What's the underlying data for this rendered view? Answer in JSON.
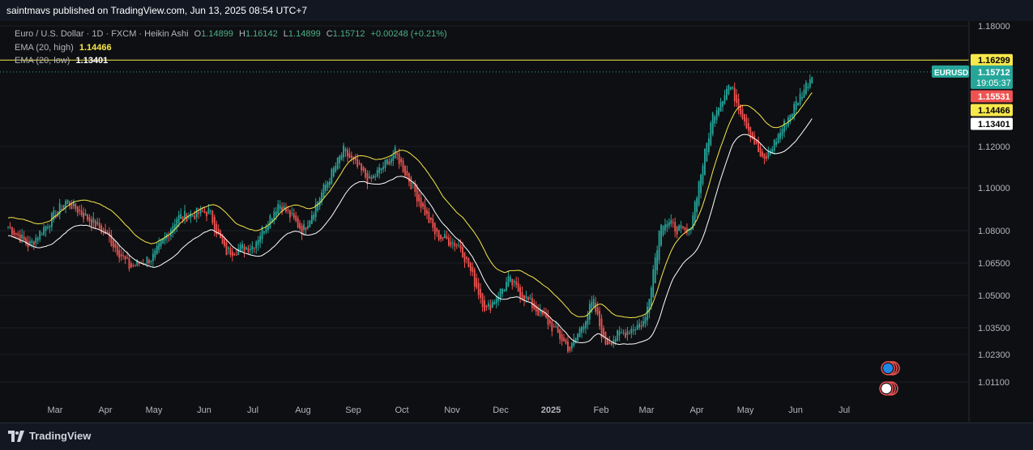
{
  "header": {
    "publisher_text": "saintmavs published on TradingView.com, Jun 13, 2025 08:54 UTC+7"
  },
  "legend": {
    "symbol_line": "Euro / U.S. Dollar · 1D · FXCM · Heikin Ashi",
    "o_label": "O",
    "o_value": "1.14899",
    "h_label": "H",
    "h_value": "1.16142",
    "l_label": "L",
    "l_value": "1.14899",
    "c_label": "C",
    "c_value": "1.15712",
    "change": "+0.00248 (+0.21%)",
    "ema_high_label": "EMA (20, high)",
    "ema_high_value": "1.14466",
    "ema_low_label": "EMA (20, low)",
    "ema_low_value": "1.13401"
  },
  "price_labels": {
    "symbol": "EURUSD",
    "last_price": "1.15712",
    "countdown": "19:05:37",
    "resistance": "1.16299",
    "red_level": "1.15531",
    "ema_high": "1.14466",
    "ema_low": "1.13401"
  },
  "footer": {
    "brand": "TradingView"
  },
  "colors": {
    "up": "#26a69a",
    "down": "#ef5350",
    "ema_high": "#f7e84b",
    "ema_low": "#ffffff",
    "background": "#0e0f12",
    "resistance_line": "#f7e84b"
  },
  "chart_data": {
    "type": "candlestick",
    "title": "Euro / U.S. Dollar · 1D · FXCM · Heikin Ashi",
    "y_ticks": [
      "1.18000",
      "1.12000",
      "1.10000",
      "1.08000",
      "1.06500",
      "1.05000",
      "1.03500",
      "1.02300",
      "1.01100"
    ],
    "y_tick_values": [
      1.18,
      1.12,
      1.1,
      1.08,
      1.065,
      1.05,
      1.035,
      1.023,
      1.011
    ],
    "x_ticks": [
      "Mar",
      "Apr",
      "May",
      "Jun",
      "Jul",
      "Aug",
      "Sep",
      "Oct",
      "Nov",
      "Dec",
      "2025",
      "Feb",
      "Mar",
      "Apr",
      "May",
      "Jun",
      "Jul"
    ],
    "x_tick_bold": [
      false,
      false,
      false,
      false,
      false,
      false,
      false,
      false,
      false,
      false,
      true,
      false,
      false,
      false,
      false,
      false,
      false
    ],
    "price_anchors": [
      [
        "2024-02-01",
        1.082
      ],
      [
        "2024-02-14",
        1.073
      ],
      [
        "2024-03-08",
        1.094
      ],
      [
        "2024-04-01",
        1.079
      ],
      [
        "2024-04-16",
        1.063
      ],
      [
        "2024-05-01",
        1.068
      ],
      [
        "2024-05-15",
        1.086
      ],
      [
        "2024-06-04",
        1.089
      ],
      [
        "2024-06-14",
        1.07
      ],
      [
        "2024-07-01",
        1.073
      ],
      [
        "2024-07-17",
        1.093
      ],
      [
        "2024-08-01",
        1.08
      ],
      [
        "2024-08-26",
        1.118
      ],
      [
        "2024-09-11",
        1.103
      ],
      [
        "2024-09-27",
        1.117
      ],
      [
        "2024-10-22",
        1.078
      ],
      [
        "2024-11-06",
        1.073
      ],
      [
        "2024-11-22",
        1.043
      ],
      [
        "2024-12-06",
        1.057
      ],
      [
        "2024-12-31",
        1.037
      ],
      [
        "2025-01-13",
        1.025
      ],
      [
        "2025-01-27",
        1.047
      ],
      [
        "2025-02-03",
        1.028
      ],
      [
        "2025-02-28",
        1.038
      ],
      [
        "2025-03-10",
        1.085
      ],
      [
        "2025-03-27",
        1.078
      ],
      [
        "2025-04-11",
        1.136
      ],
      [
        "2025-04-21",
        1.151
      ],
      [
        "2025-05-12",
        1.112
      ],
      [
        "2025-06-12",
        1.157
      ]
    ],
    "series": [
      {
        "name": "EMA (20, high)",
        "last": 1.14466
      },
      {
        "name": "EMA (20, low)",
        "last": 1.13401
      }
    ],
    "horizontal_line": 1.16299
  }
}
